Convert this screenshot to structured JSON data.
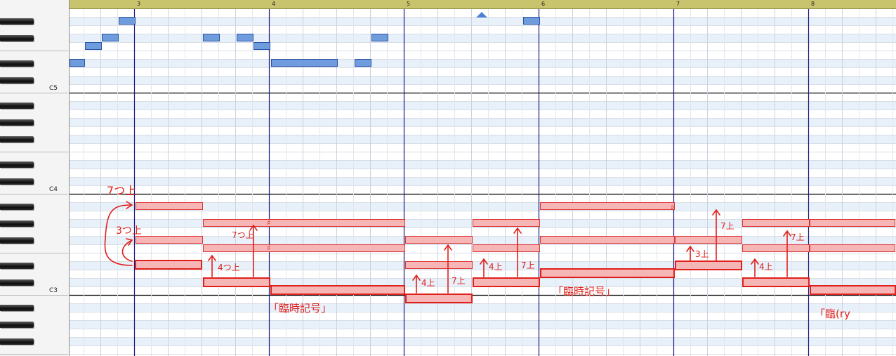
{
  "ruler": {
    "bar_numbers": [
      "3",
      "4",
      "5",
      "6",
      "7",
      "8"
    ]
  },
  "keyboard": {
    "octave_labels": [
      "C5",
      "C4",
      "C3"
    ]
  },
  "annotations": {
    "interval_7_up": "7つ上",
    "interval_3_up": "3つ上",
    "four_up": "4上",
    "seven_up": "7上",
    "three_up": "3上",
    "four_up_note": "4つ上",
    "seven_up_note": "7つ上",
    "accidental_1": "「臨時記号」",
    "accidental_2": "「臨時記号」",
    "accidental_3": "「臨(ry"
  },
  "colors": {
    "bass_note_fill": "#f7b6b6",
    "bass_note_border": "#dd3333",
    "melody_note": "#6f9cdc",
    "annotation": "#e0201a",
    "ruler": "#c8c46e"
  }
}
